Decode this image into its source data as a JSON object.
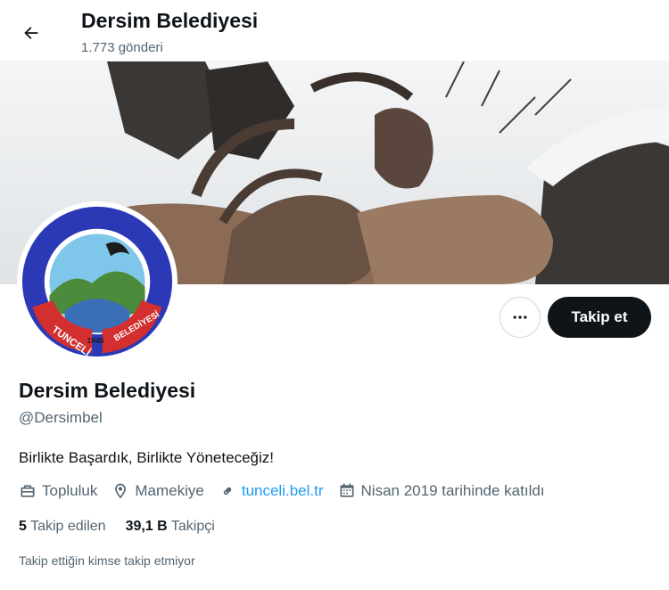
{
  "header": {
    "title": "Dersim Belediyesi",
    "post_count": "1.773 gönderi",
    "back_icon": "arrow-left-icon"
  },
  "banner": {
    "description": "Mountain goats in snowy rocky landscape"
  },
  "avatar": {
    "ring_text_left": "TUNCELİ",
    "ring_text_right": "BELEDİYESİ",
    "year": "1945"
  },
  "actions": {
    "more_icon": "more-dots-icon",
    "follow_label": "Takip et"
  },
  "profile": {
    "name": "Dersim Belediyesi",
    "handle": "@Dersimbel",
    "bio": "Birlikte Başardık, Birlikte Yöneteceğiz!"
  },
  "meta": {
    "category": "Topluluk",
    "location": "Mamekiye",
    "website": "tunceli.bel.tr",
    "joined": "Nisan 2019 tarihinde katıldı"
  },
  "counts": {
    "following_value": "5",
    "following_label": "Takip edilen",
    "followers_value": "39,1 B",
    "followers_label": "Takipçi"
  },
  "note": "Takip ettiğin kimse takip etmiyor",
  "colors": {
    "accent": "#1d9bf0",
    "text": "#0f1419",
    "muted": "#536471"
  }
}
